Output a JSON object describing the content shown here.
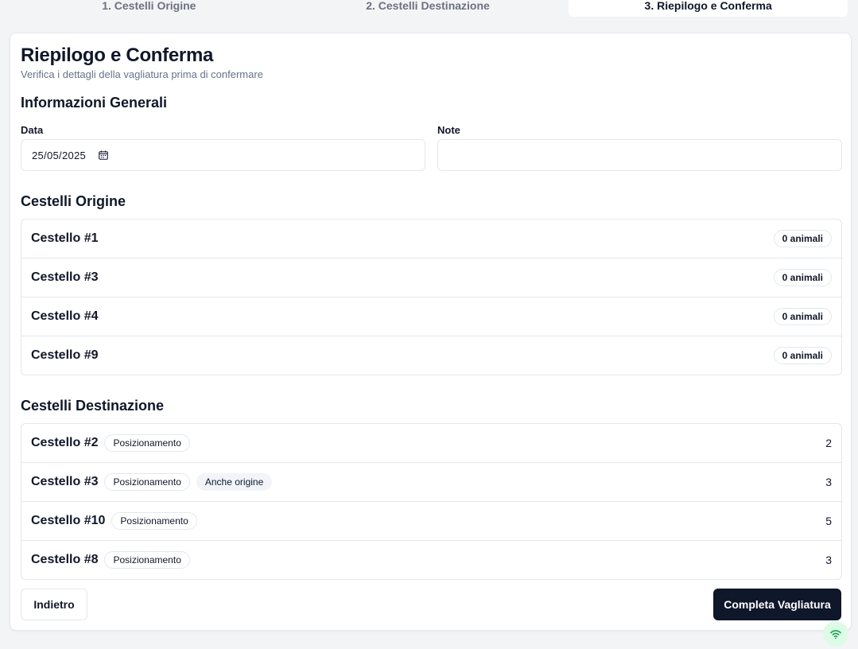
{
  "steps": [
    "1. Cestelli Origine",
    "2. Cestelli Destinazione",
    "3. Riepilogo e Conferma"
  ],
  "header": {
    "title": "Riepilogo e Conferma",
    "subtitle": "Verifica i dettagli della vagliatura prima di confermare"
  },
  "general": {
    "heading": "Informazioni Generali",
    "date_label": "Data",
    "date_value": "25/05/2025",
    "note_label": "Note",
    "note_value": ""
  },
  "origin": {
    "heading": "Cestelli Origine",
    "items": [
      {
        "name": "Cestello #1",
        "badge": "0 animali"
      },
      {
        "name": "Cestello #3",
        "badge": "0 animali"
      },
      {
        "name": "Cestello #4",
        "badge": "0 animali"
      },
      {
        "name": "Cestello #9",
        "badge": "0 animali"
      }
    ]
  },
  "destination": {
    "heading": "Cestelli Destinazione",
    "items": [
      {
        "name": "Cestello #2",
        "tag": "Posizionamento",
        "extra": "",
        "count": "2"
      },
      {
        "name": "Cestello #3",
        "tag": "Posizionamento",
        "extra": "Anche origine",
        "count": "3"
      },
      {
        "name": "Cestello #10",
        "tag": "Posizionamento",
        "extra": "",
        "count": "5"
      },
      {
        "name": "Cestello #8",
        "tag": "Posizionamento",
        "extra": "",
        "count": "3"
      }
    ]
  },
  "actions": {
    "back_label": "Indietro",
    "complete_label": "Completa Vagliatura"
  },
  "icons": {
    "calendar": "calendar-icon",
    "status": "wifi-icon"
  },
  "colors": {
    "primary": "#0f172a",
    "online": "#16a34a"
  }
}
